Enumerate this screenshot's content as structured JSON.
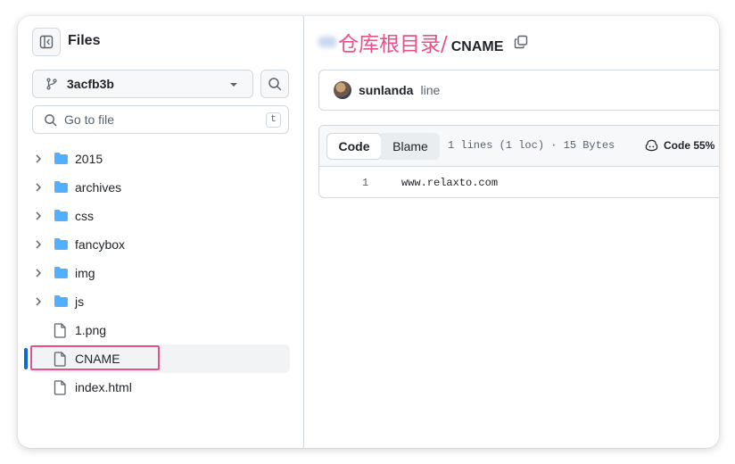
{
  "sidebar": {
    "title": "Files",
    "branch": "3acfb3b",
    "goto_placeholder": "Go to file",
    "goto_shortcut": "t",
    "items": [
      {
        "label": "2015",
        "type": "folder"
      },
      {
        "label": "archives",
        "type": "folder"
      },
      {
        "label": "css",
        "type": "folder"
      },
      {
        "label": "fancybox",
        "type": "folder"
      },
      {
        "label": "img",
        "type": "folder"
      },
      {
        "label": "js",
        "type": "folder"
      },
      {
        "label": "1.png",
        "type": "file"
      },
      {
        "label": "CNAME",
        "type": "file",
        "selected": true
      },
      {
        "label": "index.html",
        "type": "file"
      }
    ]
  },
  "breadcrumb": {
    "annotation": "仓库根目录",
    "separator": "/",
    "file": "CNAME"
  },
  "commit": {
    "author": "sunlanda",
    "message": "line"
  },
  "file_view": {
    "tab_code": "Code",
    "tab_blame": "Blame",
    "meta": "1 lines (1 loc) · 15 Bytes",
    "copilot_label": "Code 55%",
    "lines": [
      {
        "num": "1",
        "text": "www.relaxto.com"
      }
    ]
  },
  "colors": {
    "accent": "#0969da",
    "folder": "#54aeff",
    "annotation": "#e8508c"
  },
  "icons": {
    "toggle": "sidebar-collapse-icon",
    "branch": "git-branch-icon",
    "search": "search-icon",
    "folder": "folder-icon",
    "file": "file-icon",
    "copy": "copy-icon",
    "copilot": "copilot-icon"
  }
}
